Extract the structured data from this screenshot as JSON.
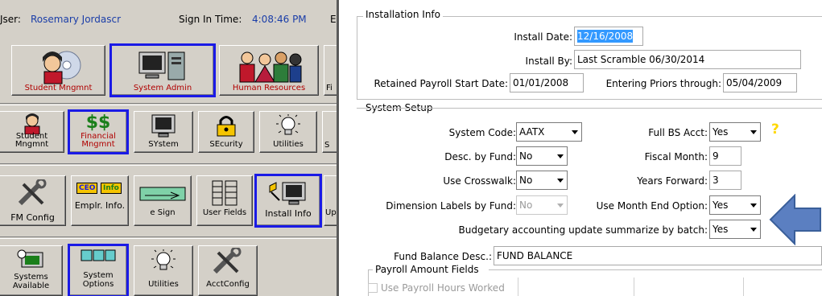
{
  "topbar": {
    "user_label": "Jser:",
    "user_name": "Rosemary Jordascr",
    "signin_label": "Sign In Time:",
    "signin_time": "4:08:46 PM",
    "cutoff": "E"
  },
  "tiles": {
    "row1": [
      "Student Mngmnt",
      "System Admin",
      "Human Resources",
      "Fi"
    ],
    "row2": [
      "Student Mngmnt",
      "Financial Mngmnt",
      "SYstem",
      "SEcurity",
      "Utilities",
      "S"
    ],
    "row3": [
      "FM Config",
      "Emplr. Info.",
      "e Sign",
      "User Fields",
      "Install Info",
      "Up"
    ],
    "row3_ceo_text": "CEO",
    "row3_info_text": "Info",
    "row4": [
      "Systems Available",
      "System Options",
      "Utilities",
      "AcctConfig"
    ],
    "dollar": "$$"
  },
  "install": {
    "group_title": "Installation Info",
    "install_date_label": "Install Date:",
    "install_date": "12/16/2008",
    "install_by_label": "Install By:",
    "install_by": "Last Scramble 06/30/2014",
    "payroll_start_label": "Retained Payroll Start Date:",
    "payroll_start": "01/01/2008",
    "priors_label": "Entering Priors through:",
    "priors": "05/04/2009"
  },
  "setup": {
    "group_title": "System Setup",
    "system_code_label": "System Code:",
    "system_code": "AATX",
    "full_bs_label": "Full BS Acct:",
    "full_bs": "Yes",
    "desc_fund_label": "Desc. by Fund:",
    "desc_fund": "No",
    "fiscal_month_label": "Fiscal Month:",
    "fiscal_month": "9",
    "crosswalk_label": "Use Crosswalk:",
    "crosswalk": "No",
    "years_fwd_label": "Years Forward:",
    "years_fwd": "3",
    "dim_labels_label": "Dimension Labels by Fund:",
    "dim_labels": "No",
    "month_end_label": "Use Month End Option:",
    "month_end": "Yes",
    "budgetary_label": "Budgetary accounting update summarize by batch:",
    "budgetary": "Yes",
    "fund_balance_label": "Fund Balance Desc.:",
    "fund_balance": "FUND BALANCE",
    "question_mark": "?"
  },
  "payroll": {
    "group_title": "Payroll Amount Fields",
    "use_hours_label": "Use Payroll Hours Worked"
  },
  "colors": {
    "accent_blue": "#1a1ae6",
    "arrow_fill": "#5b7fc1",
    "arrow_stroke": "#3a5f9a",
    "question": "#ffd800"
  }
}
